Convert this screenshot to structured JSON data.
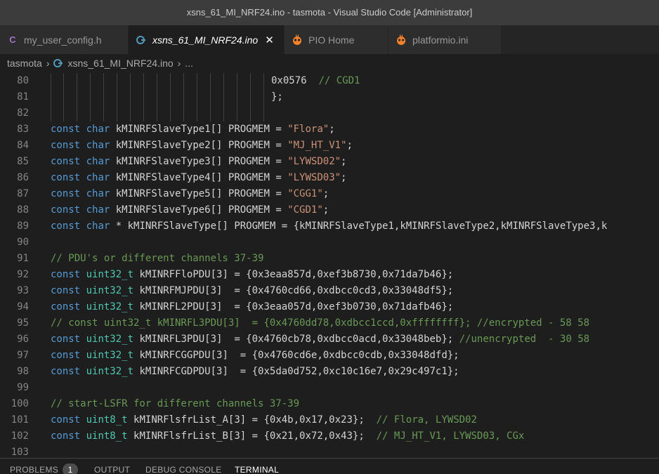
{
  "window": {
    "title": "xsns_61_MI_NRF24.ino - tasmota - Visual Studio Code [Administrator]"
  },
  "tabs": [
    {
      "label": "my_user_config.h",
      "icon": "C",
      "icon_color": "#a074c4"
    },
    {
      "label": "xsns_61_MI_NRF24.ino",
      "icon": "G",
      "icon_color": "#519aba",
      "active": true,
      "close": "✕"
    },
    {
      "label": "PIO Home",
      "icon": "alien",
      "icon_color": "#f5822a"
    },
    {
      "label": "platformio.ini",
      "icon": "alien",
      "icon_color": "#f5822a"
    }
  ],
  "breadcrumb": {
    "folder": "tasmota",
    "sep1": "›",
    "file": "xsns_61_MI_NRF24.ino",
    "sep2": "›",
    "more": "..."
  },
  "editor": {
    "lines": [
      {
        "n": "80",
        "code": "0x0576  // CGD1"
      },
      {
        "n": "81",
        "code": "};"
      },
      {
        "n": "82",
        "code": ""
      },
      {
        "n": "83",
        "code": "const char kMINRFSlaveType1[] PROGMEM = \"Flora\";"
      },
      {
        "n": "84",
        "code": "const char kMINRFSlaveType2[] PROGMEM = \"MJ_HT_V1\";"
      },
      {
        "n": "85",
        "code": "const char kMINRFSlaveType3[] PROGMEM = \"LYWSD02\";"
      },
      {
        "n": "86",
        "code": "const char kMINRFSlaveType4[] PROGMEM = \"LYWSD03\";"
      },
      {
        "n": "87",
        "code": "const char kMINRFSlaveType5[] PROGMEM = \"CGG1\";"
      },
      {
        "n": "88",
        "code": "const char kMINRFSlaveType6[] PROGMEM = \"CGD1\";"
      },
      {
        "n": "89",
        "code": "const char * kMINRFSlaveType[] PROGMEM = {kMINRFSlaveType1,kMINRFSlaveType2,kMINRFSlaveType3,k"
      },
      {
        "n": "90",
        "code": ""
      },
      {
        "n": "91",
        "code": "// PDU's or different channels 37-39"
      },
      {
        "n": "92",
        "code": "const uint32_t kMINRFFloPDU[3] = {0x3eaa857d,0xef3b8730,0x71da7b46};"
      },
      {
        "n": "93",
        "code": "const uint32_t kMINRFMJPDU[3]  = {0x4760cd66,0xdbcc0cd3,0x33048df5};"
      },
      {
        "n": "94",
        "code": "const uint32_t kMINRFL2PDU[3]  = {0x3eaa057d,0xef3b0730,0x71dafb46};"
      },
      {
        "n": "95",
        "code": "// const uint32_t kMINRFL3PDU[3]  = {0x4760dd78,0xdbcc1ccd,0xffffffff}; //encrypted - 58 58"
      },
      {
        "n": "96",
        "code": "const uint32_t kMINRFL3PDU[3]  = {0x4760cb78,0xdbcc0acd,0x33048beb}; //unencrypted  - 30 58"
      },
      {
        "n": "97",
        "code": "const uint32_t kMINRFCGGPDU[3]  = {0x4760cd6e,0xdbcc0cdb,0x33048dfd};"
      },
      {
        "n": "98",
        "code": "const uint32_t kMINRFCGDPDU[3]  = {0x5da0d752,0xc10c16e7,0x29c497c1};"
      },
      {
        "n": "99",
        "code": ""
      },
      {
        "n": "100",
        "code": "// start-LSFR for different channels 37-39"
      },
      {
        "n": "101",
        "code": "const uint8_t kMINRFlsfrList_A[3] = {0x4b,0x17,0x23};  // Flora, LYWSD02"
      },
      {
        "n": "102",
        "code": "const uint8_t kMINRFlsfrList_B[3] = {0x21,0x72,0x43};  // MJ_HT_V1, LYWSD03, CGx"
      },
      {
        "n": "103",
        "code": ""
      }
    ]
  },
  "panel": {
    "tabs": [
      {
        "label": "PROBLEMS",
        "badge": "1"
      },
      {
        "label": "OUTPUT"
      },
      {
        "label": "DEBUG CONSOLE"
      },
      {
        "label": "TERMINAL",
        "active": true
      }
    ]
  },
  "colors": {
    "keyword": "#569cd6",
    "type": "#4ec9b0",
    "string": "#ce9178",
    "comment": "#6a9955",
    "text": "#d4d4d4"
  }
}
